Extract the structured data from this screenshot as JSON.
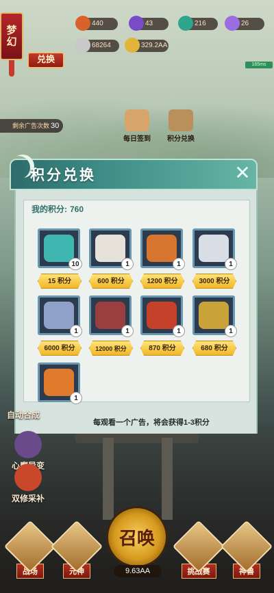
{
  "top": {
    "dream_label": "梦幻",
    "exchange_button": "兑换",
    "ad_count_label": "剩余广告次数",
    "ad_count_value": "30",
    "speed_label": "165ms"
  },
  "currencies": [
    {
      "name": "peach",
      "value": "440",
      "color": "#d8622a"
    },
    {
      "name": "purple-gem",
      "value": "43",
      "color": "#7a4bc8"
    },
    {
      "name": "jade",
      "value": "216",
      "color": "#2fa58d"
    },
    {
      "name": "crystal",
      "value": "26",
      "color": "#9a6de0"
    },
    {
      "name": "silver-ingot",
      "value": "68264",
      "color": "#c9c9c9"
    },
    {
      "name": "gold-coin",
      "value": "329.2AA",
      "color": "#e3b43a"
    }
  ],
  "activities": [
    {
      "label": "每日签到",
      "color": "#d7a56c"
    },
    {
      "label": "积分兑换",
      "color": "#b9905b"
    }
  ],
  "modal": {
    "title": "积分兑换",
    "points_label": "我的积分:",
    "points_value": "760",
    "ad_tip": "每观看一个广告，将会获得1-3积分",
    "items": [
      {
        "qty": "10",
        "price": "15  积分",
        "art": "#3fb7b0"
      },
      {
        "qty": "1",
        "price": "600 积分",
        "art": "#e6e2da"
      },
      {
        "qty": "1",
        "price": "1200 积分",
        "art": "#d8752e"
      },
      {
        "qty": "1",
        "price": "3000 积分",
        "art": "#d9dde6"
      },
      {
        "qty": "1",
        "price": "6000 积分",
        "art": "#8fa1c8"
      },
      {
        "qty": "1",
        "price": "12000 积分",
        "art": "#9a3f3f"
      },
      {
        "qty": "1",
        "price": "870 积分",
        "art": "#c5412a"
      },
      {
        "qty": "1",
        "price": "680 积分",
        "art": "#c9a23a"
      },
      {
        "qty": "1",
        "price": "",
        "art": "#e07a2c"
      }
    ]
  },
  "side_menu": [
    {
      "label": "自动合成"
    },
    {
      "label": "心魔异变"
    },
    {
      "label": "双修采补"
    }
  ],
  "bottom_nav": {
    "items": [
      {
        "label": "战场"
      },
      {
        "label": "元神"
      },
      {
        "label": "挑战赛"
      },
      {
        "label": "神兽"
      }
    ],
    "summon_label": "召唤",
    "summon_value": "9.63AA"
  }
}
